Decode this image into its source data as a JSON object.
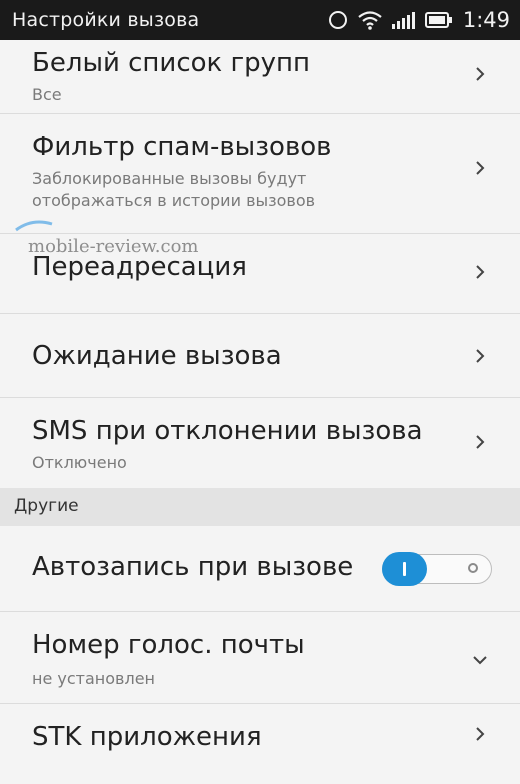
{
  "status_bar": {
    "title": "Настройки вызова",
    "time": "1:49",
    "icons": [
      "alarm-icon",
      "wifi-icon",
      "signal-icon",
      "battery-icon"
    ]
  },
  "rows": [
    {
      "title": "Белый список групп",
      "subtitle": "Все",
      "indicator": "chevron-right"
    },
    {
      "title": "Фильтр спам-вызовов",
      "subtitle_line1": "Заблокированные вызовы будут",
      "subtitle_line2": "отображаться в истории вызовов",
      "indicator": "chevron-right"
    },
    {
      "title": "Переадресация",
      "indicator": "chevron-right"
    },
    {
      "title": "Ожидание вызова",
      "indicator": "chevron-right"
    },
    {
      "title": "SMS при отклонении вызова",
      "subtitle": "Отключено",
      "indicator": "chevron-right"
    }
  ],
  "section_other": {
    "label": "Другие"
  },
  "rows_other": [
    {
      "title": "Автозапись при вызове",
      "indicator": "toggle",
      "toggle_on": true
    },
    {
      "title": "Номер голос. почты",
      "subtitle": "не установлен",
      "indicator": "chevron-down"
    },
    {
      "title": "STK приложения",
      "indicator": "chevron-right"
    }
  ],
  "watermark": "mobile-review.com",
  "colors": {
    "accent": "#1e8fd6",
    "status_bar": "#1a1a1a",
    "background": "#f4f4f4",
    "section": "#e3e3e3"
  }
}
